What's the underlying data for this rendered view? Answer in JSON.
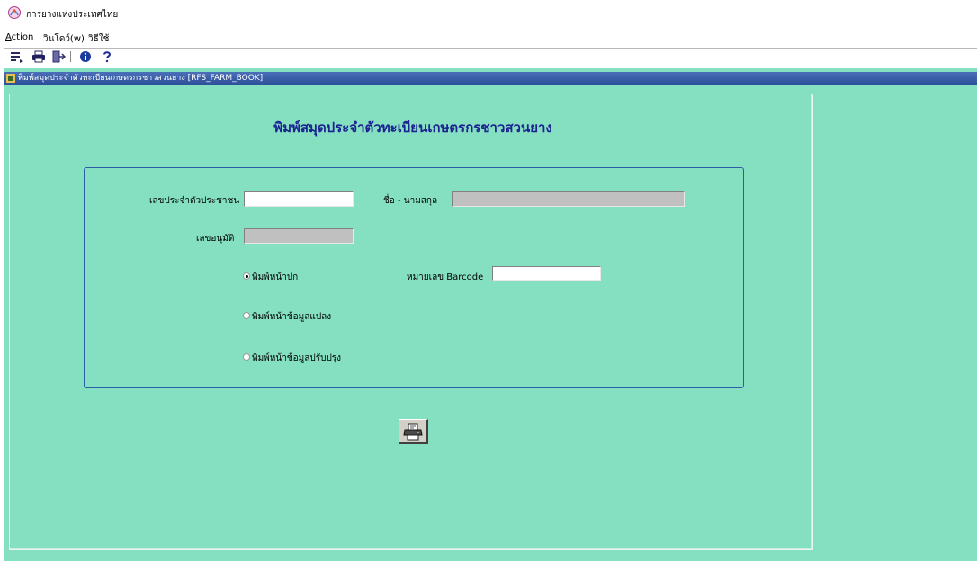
{
  "window": {
    "title": "การยางแห่งประเทศไทย"
  },
  "menu": {
    "items": [
      {
        "label": "Action",
        "mnemonic": "A"
      },
      {
        "label": "วินโดว์(w)"
      },
      {
        "label": "วิธีใช้"
      }
    ]
  },
  "toolbar": {
    "buttons": [
      {
        "icon": "page-setup-icon"
      },
      {
        "icon": "print-icon"
      },
      {
        "icon": "exit-icon"
      },
      {
        "icon": "info-icon"
      },
      {
        "icon": "help-icon"
      }
    ]
  },
  "form": {
    "title": "พิมพ์สมุดประจำตัวทะเบียนเกษตรกรชาวสวนยาง [RFS_FARM_BOOK]",
    "heading": "พิมพ์สมุดประจำตัวทะเบียนเกษตรกรชาวสวนยาง",
    "fields": {
      "citizen_id": {
        "label": "เลขประจำตัวประชาชน",
        "value": ""
      },
      "full_name": {
        "label": "ชื่อ - นามสกุล",
        "value": ""
      },
      "approval_no": {
        "label": "เลขอนุมัติ",
        "value": ""
      },
      "barcode": {
        "label": "หมายเลข Barcode",
        "value": ""
      }
    },
    "options": [
      {
        "label": "พิมพ์หน้าปก",
        "checked": true
      },
      {
        "label": "พิมพ์หน้าข้อมูลแปลง",
        "checked": false
      },
      {
        "label": "พิมพ์หน้าข้อมูลปรับปรุง",
        "checked": false
      }
    ],
    "print_button": {
      "icon": "printer-icon"
    }
  },
  "colors": {
    "form_bg": "#85e0c2",
    "heading": "#1c2290",
    "inner_titlebar": "#2e4f9a",
    "group_border": "#2c5ea8",
    "disabled_field": "#c0c0c0"
  }
}
